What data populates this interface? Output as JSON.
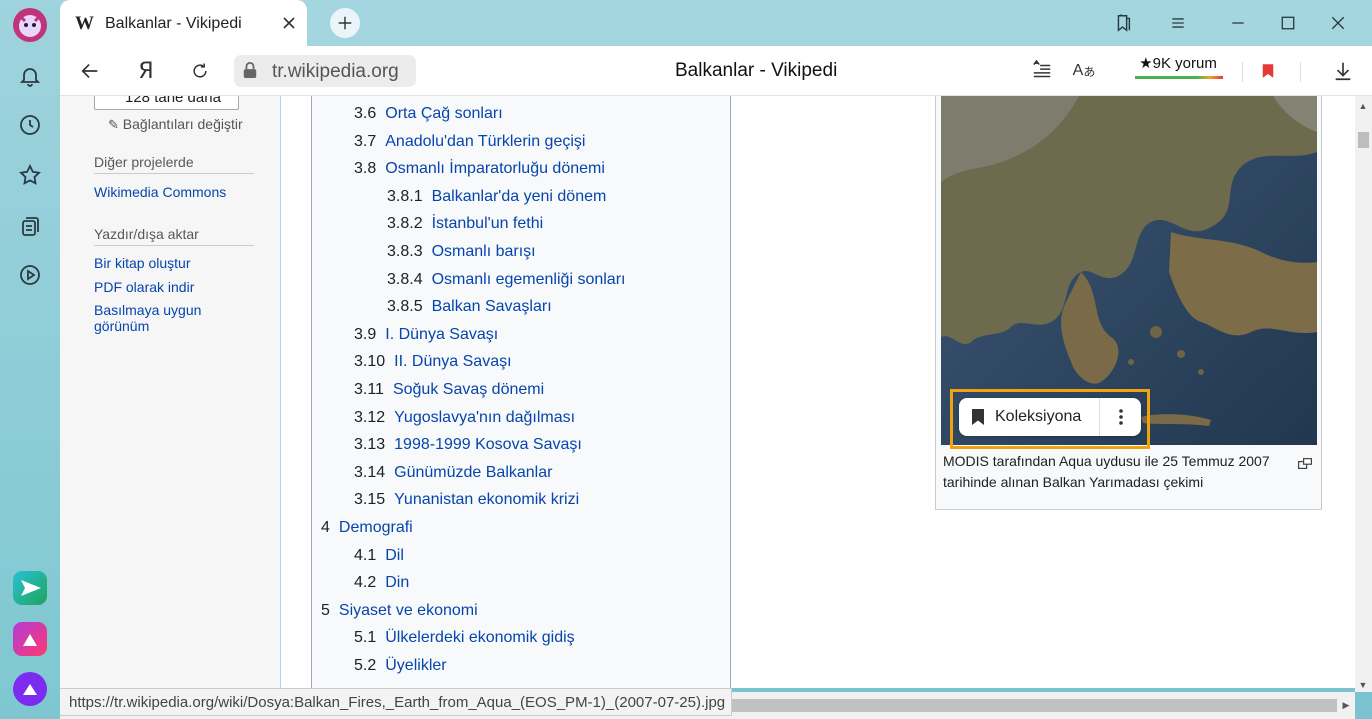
{
  "browser": {
    "tab_title": "Balkanlar - Vikipedi",
    "tab_favicon": "W",
    "url": "tr.wikipedia.org",
    "page_title": "Balkanlar - Vikipedi",
    "reviews_label": "★9K yorum",
    "status_url": "https://tr.wikipedia.org/wiki/Dosya:Balkan_Fires,_Earth_from_Aqua_(EOS_PM-1)_(2007-07-25).jpg"
  },
  "sidebar_left": {
    "more_button": "128 tane daha",
    "edit_links": "Bağlantıları değiştir",
    "other_projects_heading": "Diğer projelerde",
    "other_projects_link": "Wikimedia Commons",
    "print_heading": "Yazdır/dışa aktar",
    "print_links": [
      "Bir kitap oluştur",
      "PDF olarak indir",
      "Basılmaya uygun görünüm"
    ]
  },
  "toc": [
    {
      "num": "3.6",
      "text": "Orta Çağ sonları",
      "level": 2
    },
    {
      "num": "3.7",
      "text": "Anadolu'dan Türklerin geçişi",
      "level": 2
    },
    {
      "num": "3.8",
      "text": "Osmanlı İmparatorluğu dönemi",
      "level": 2
    },
    {
      "num": "3.8.1",
      "text": "Balkanlar'da yeni dönem",
      "level": 3
    },
    {
      "num": "3.8.2",
      "text": "İstanbul'un fethi",
      "level": 3
    },
    {
      "num": "3.8.3",
      "text": "Osmanlı barışı",
      "level": 3
    },
    {
      "num": "3.8.4",
      "text": "Osmanlı egemenliği sonları",
      "level": 3
    },
    {
      "num": "3.8.5",
      "text": "Balkan Savaşları",
      "level": 3
    },
    {
      "num": "3.9",
      "text": "I. Dünya Savaşı",
      "level": 2
    },
    {
      "num": "3.10",
      "text": "II. Dünya Savaşı",
      "level": 2
    },
    {
      "num": "3.11",
      "text": "Soğuk Savaş dönemi",
      "level": 2
    },
    {
      "num": "3.12",
      "text": "Yugoslavya'nın dağılması",
      "level": 2
    },
    {
      "num": "3.13",
      "text": "1998-1999 Kosova Savaşı",
      "level": 2
    },
    {
      "num": "3.14",
      "text": "Günümüzde Balkanlar",
      "level": 2
    },
    {
      "num": "3.15",
      "text": "Yunanistan ekonomik krizi",
      "level": 2
    },
    {
      "num": "4",
      "text": "Demografi",
      "level": 1
    },
    {
      "num": "4.1",
      "text": "Dil",
      "level": 2
    },
    {
      "num": "4.2",
      "text": "Din",
      "level": 2
    },
    {
      "num": "5",
      "text": "Siyaset ve ekonomi",
      "level": 1
    },
    {
      "num": "5.1",
      "text": "Ülkelerdeki ekonomik gidiş",
      "level": 2
    },
    {
      "num": "5.2",
      "text": "Üyelikler",
      "level": 2
    }
  ],
  "thumbnail": {
    "caption": "MODIS tarafından Aqua uydusu ile 25 Temmuz 2007 tarihinde alınan Balkan Yarımadası çekimi",
    "collection_button": "Koleksiyona"
  },
  "colors": {
    "link": "#0645ad",
    "highlight": "#f0a30a",
    "sidebar_bg": "#7cc2d0"
  }
}
